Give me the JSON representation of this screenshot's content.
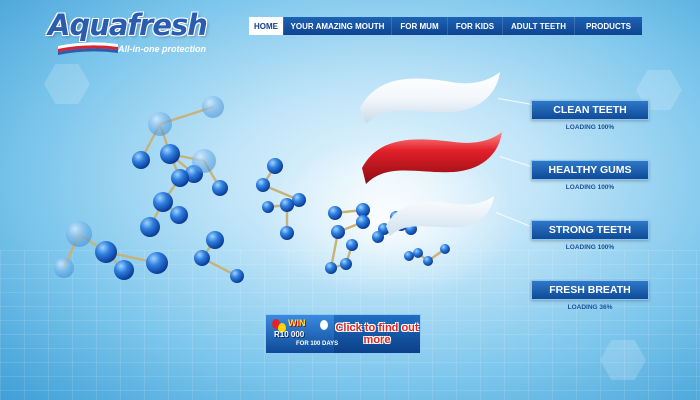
{
  "brand": {
    "name": "Aquafresh",
    "tagline": "All-in-one protection",
    "colors": {
      "blue": "#2a5db0",
      "red": "#d9232e",
      "white": "#ffffff"
    }
  },
  "nav": {
    "items": [
      {
        "label": "HOME",
        "active": true
      },
      {
        "label": "YOUR AMAZING MOUTH",
        "active": false
      },
      {
        "label": "FOR MUM",
        "active": false
      },
      {
        "label": "FOR KIDS",
        "active": false
      },
      {
        "label": "ADULT TEETH",
        "active": false
      },
      {
        "label": "PRODUCTS",
        "active": false
      }
    ]
  },
  "benefits": [
    {
      "label": "CLEAN TEETH",
      "status": "LOADING 100%",
      "progress": 1.0
    },
    {
      "label": "HEALTHY GUMS",
      "status": "LOADING 100%",
      "progress": 1.0
    },
    {
      "label": "STRONG TEETH",
      "status": "LOADING 100%",
      "progress": 1.0
    },
    {
      "label": "FRESH BREATH",
      "status": "LOADING 36%",
      "progress": 0.36
    }
  ],
  "promo": {
    "win": "WIN",
    "amount": "R10 000",
    "period": "FOR 100 DAYS",
    "cta": "Click to find out more"
  },
  "icons": [
    "molecule-icon",
    "toothpaste-stripe-icon"
  ]
}
